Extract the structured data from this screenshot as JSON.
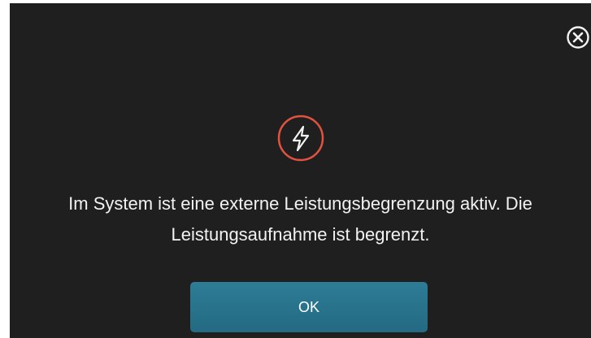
{
  "dialog": {
    "icon": "lightning-bolt-icon",
    "message_line1": "Im System ist eine externe Leistungsbegrenzung aktiv. Die",
    "message_line2": "Leistungsaufnahme ist begrenzt.",
    "ok_label": "OK",
    "close_icon": "close-circle-icon"
  },
  "colors": {
    "background": "#1f1f1f",
    "text": "#f2f2f2",
    "icon_ring": "#e0533f",
    "button": "#2a7690"
  }
}
